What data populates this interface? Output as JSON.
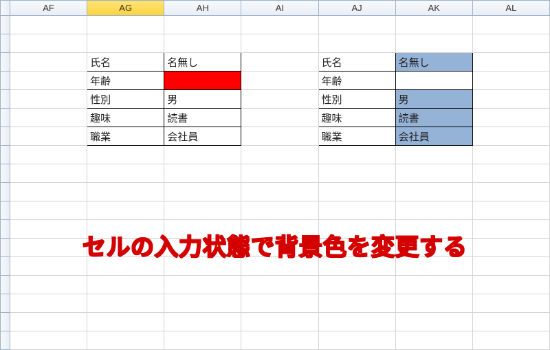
{
  "columns": [
    "AF",
    "AG",
    "AH",
    "AI",
    "AJ",
    "AK",
    "AL"
  ],
  "selected_column_index": 1,
  "table_left": {
    "rows": [
      {
        "label": "氏名",
        "value": "名無し",
        "highlight": ""
      },
      {
        "label": "年齢",
        "value": "",
        "highlight": "red"
      },
      {
        "label": "性別",
        "value": "男",
        "highlight": ""
      },
      {
        "label": "趣味",
        "value": "読書",
        "highlight": ""
      },
      {
        "label": "職業",
        "value": "会社員",
        "highlight": ""
      }
    ]
  },
  "table_right": {
    "rows": [
      {
        "label": "氏名",
        "value": "名無し",
        "highlight": "blue"
      },
      {
        "label": "年齢",
        "value": "",
        "highlight": ""
      },
      {
        "label": "性別",
        "value": "男",
        "highlight": "blue"
      },
      {
        "label": "趣味",
        "value": "読書",
        "highlight": "blue"
      },
      {
        "label": "職業",
        "value": "会社員",
        "highlight": "blue"
      }
    ]
  },
  "caption": "セルの入力状態で背景色を変更する",
  "chart_data": {
    "type": "table",
    "title": "セルの入力状態で背景色を変更する",
    "tables": [
      {
        "name": "left",
        "rows": [
          [
            "氏名",
            "名無し"
          ],
          [
            "年齢",
            ""
          ],
          [
            "性別",
            "男"
          ],
          [
            "趣味",
            "読書"
          ],
          [
            "職業",
            "会社員"
          ]
        ],
        "value_highlight": [
          "none",
          "red",
          "none",
          "none",
          "none"
        ]
      },
      {
        "name": "right",
        "rows": [
          [
            "氏名",
            "名無し"
          ],
          [
            "年齢",
            ""
          ],
          [
            "性別",
            "男"
          ],
          [
            "趣味",
            "読書"
          ],
          [
            "職業",
            "会社員"
          ]
        ],
        "value_highlight": [
          "blue",
          "none",
          "blue",
          "blue",
          "blue"
        ]
      }
    ]
  }
}
